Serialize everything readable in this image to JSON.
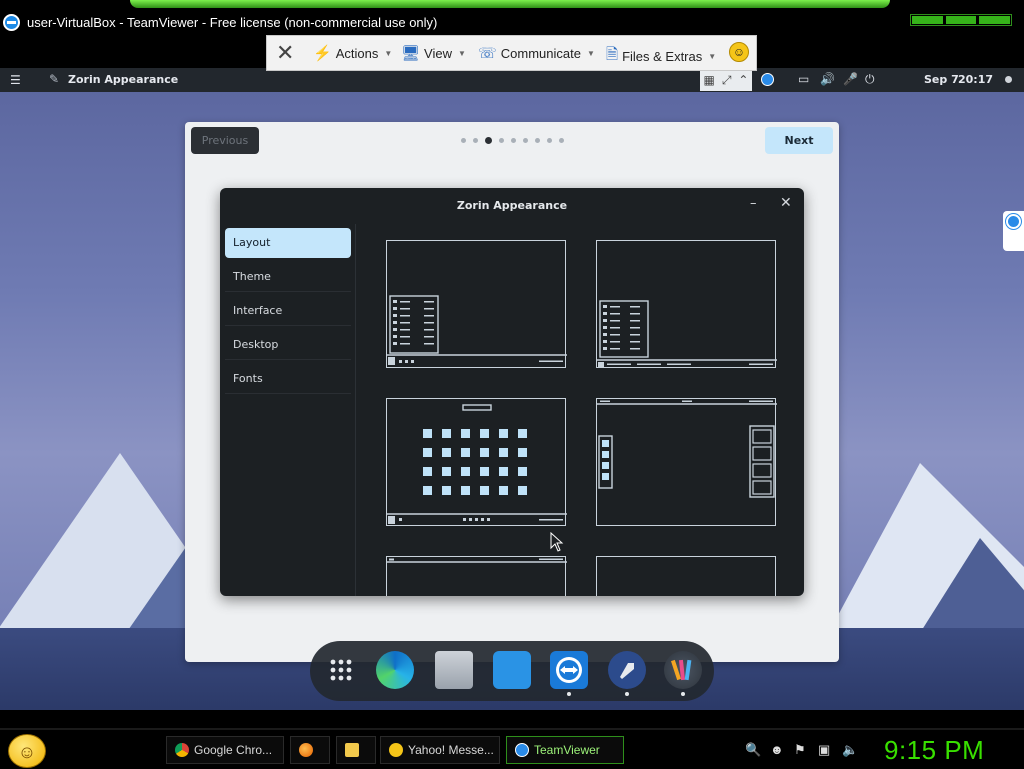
{
  "teamviewer": {
    "window_title": "user-VirtualBox - TeamViewer - Free license (non-commercial use only)",
    "toolbar": {
      "actions": "Actions",
      "view": "View",
      "communicate": "Communicate",
      "files_extras": "Files & Extras"
    }
  },
  "zorin_panel": {
    "app_name": "Zorin Appearance",
    "date": "Sep 7",
    "time": "20:17"
  },
  "tour": {
    "previous_label": "Previous",
    "next_label": "Next",
    "page_count": 9,
    "active_page": 3
  },
  "appearance_window": {
    "title": "Zorin Appearance",
    "sidebar": [
      {
        "label": "Layout",
        "active": true
      },
      {
        "label": "Theme",
        "active": false
      },
      {
        "label": "Interface",
        "active": false
      },
      {
        "label": "Desktop",
        "active": false
      },
      {
        "label": "Fonts",
        "active": false
      }
    ]
  },
  "dock": {
    "apps": [
      "app-grid",
      "microsoft-edge",
      "files",
      "software-store",
      "teamviewer",
      "zorin-connect",
      "zorin-appearance"
    ]
  },
  "taskbar": {
    "buttons": [
      {
        "label": "Google Chro...",
        "icon": "chrome-icon"
      },
      {
        "label": "",
        "icon": "firefox-icon"
      },
      {
        "label": "",
        "icon": "folder-icon"
      },
      {
        "label": "Yahoo! Messe...",
        "icon": "yahoo-messenger-icon"
      },
      {
        "label": "TeamViewer",
        "icon": "teamviewer-icon"
      }
    ],
    "clock": "9:15 PM"
  },
  "colors": {
    "accent": "#c4e6fb",
    "clock_green": "#39e000",
    "teamviewer_blue": "#2a8be8"
  }
}
